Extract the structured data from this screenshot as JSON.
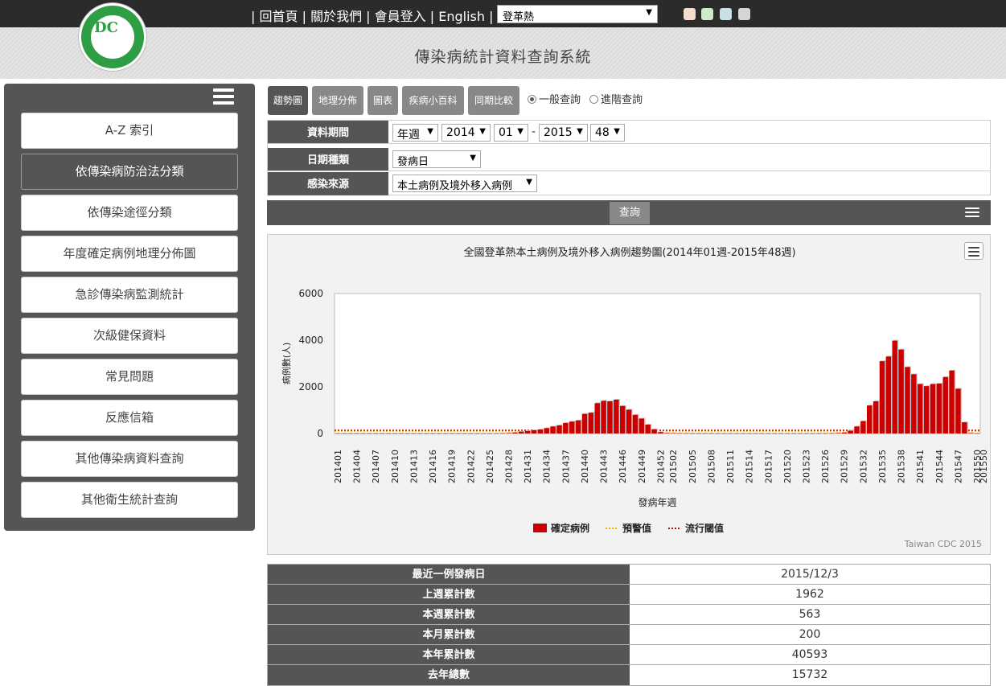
{
  "topnav": {
    "home": "回首頁",
    "about": "關於我們",
    "login": "會員登入",
    "english": "English",
    "disease_selected": "登革熱"
  },
  "theme_swatches": [
    "#f6dccc",
    "#cfe9c9",
    "#c9dfe9",
    "#d6d6d6"
  ],
  "header": {
    "title": "傳染病統計資料查詢系統"
  },
  "sidebar": {
    "items": [
      {
        "label": "A-Z 索引"
      },
      {
        "label": "依傳染病防治法分類",
        "active": true
      },
      {
        "label": "依傳染途徑分類"
      },
      {
        "label": "年度確定病例地理分佈圖"
      },
      {
        "label": "急診傳染病監測統計"
      },
      {
        "label": "次級健保資料"
      },
      {
        "label": "常見問題"
      },
      {
        "label": "反應信箱"
      },
      {
        "label": "其他傳染病資料查詢"
      },
      {
        "label": "其他衛生統計查詢"
      }
    ]
  },
  "tabs": [
    {
      "label": "趨勢圖",
      "active": true
    },
    {
      "label": "地理分佈"
    },
    {
      "label": "圖表"
    },
    {
      "label": "疾病小百科"
    },
    {
      "label": "同期比較"
    }
  ],
  "query_mode": {
    "basic": "一般查詢",
    "advanced": "進階查詢",
    "selected": "basic"
  },
  "form": {
    "period_label": "資料期間",
    "period_unit": "年週",
    "start_year": "2014",
    "start_week": "01",
    "separator": "-",
    "end_year": "2015",
    "end_week": "48",
    "date_type_label": "日期種類",
    "date_type": "發病日",
    "source_label": "感染來源",
    "source": "本土病例及境外移入病例",
    "query_button": "查詢"
  },
  "chart_data": {
    "type": "bar",
    "title": "全國登革熱本土病例及境外移入病例趨勢圖(2014年01週-2015年48週)",
    "xlabel": "發病年週",
    "ylabel": "病例數(人)",
    "ylim": [
      0,
      6000
    ],
    "yticks": [
      0,
      2000,
      4000,
      6000
    ],
    "categories_start": "201401",
    "categories_note_ticks": [
      "201401",
      "201404",
      "201407",
      "201410",
      "201413",
      "201416",
      "201419",
      "201422",
      "201425",
      "201428",
      "201431",
      "201434",
      "201437",
      "201440",
      "201443",
      "201446",
      "201449",
      "201452",
      "201502",
      "201505",
      "201508",
      "201511",
      "201514",
      "201517",
      "201520",
      "201523",
      "201526",
      "201529",
      "201532",
      "201535",
      "201538",
      "201541",
      "201544",
      "201547",
      "201550"
    ],
    "legend": [
      "確定病例",
      "預警值",
      "流行閾值"
    ],
    "legend_colors": [
      "#cc0000",
      "#e8b400",
      "#b01010"
    ],
    "series": [
      {
        "name": "確定病例",
        "values_2014": [
          2,
          1,
          1,
          1,
          1,
          1,
          1,
          1,
          1,
          1,
          1,
          1,
          1,
          1,
          1,
          1,
          1,
          1,
          1,
          1,
          1,
          2,
          2,
          3,
          3,
          5,
          10,
          20,
          40,
          80,
          110,
          140,
          170,
          230,
          300,
          350,
          450,
          510,
          560,
          840,
          890,
          1300,
          1400,
          1380,
          1450,
          1180,
          1020,
          800,
          640,
          380,
          180,
          60
        ],
        "values_2015": [
          20,
          15,
          10,
          8,
          5,
          5,
          5,
          5,
          4,
          4,
          3,
          3,
          3,
          3,
          3,
          3,
          3,
          3,
          3,
          3,
          3,
          3,
          3,
          3,
          5,
          8,
          10,
          20,
          40,
          120,
          300,
          530,
          1200,
          1380,
          3100,
          3300,
          3980,
          3600,
          2850,
          2540,
          2120,
          2030,
          2120,
          2140,
          2420,
          2700,
          1920,
          480,
          20,
          5
        ]
      }
    ],
    "warning_level": 100,
    "epidemic_threshold": 140,
    "credit": "Taiwan CDC 2015"
  },
  "stats": [
    {
      "label": "最近一例發病日",
      "value": "2015/12/3"
    },
    {
      "label": "上週累計數",
      "value": "1962"
    },
    {
      "label": "本週累計數",
      "value": "563"
    },
    {
      "label": "本月累計數",
      "value": "200"
    },
    {
      "label": "本年累計數",
      "value": "40593"
    },
    {
      "label": "去年總數",
      "value": "15732"
    }
  ]
}
